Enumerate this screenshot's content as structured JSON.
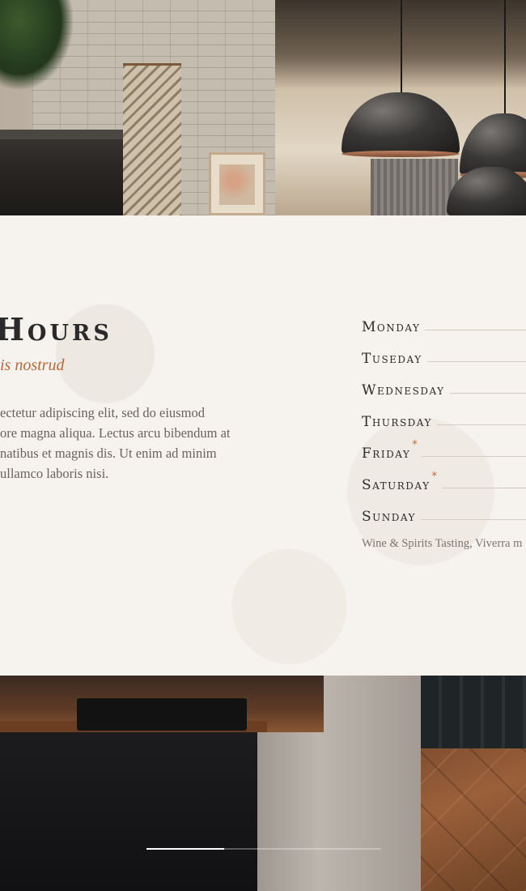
{
  "section": {
    "heading": "Hours",
    "subtitle": "is nostrud",
    "body_lines": [
      "ectetur adipiscing elit, sed do eiusmod",
      "ore magna aliqua. Lectus arcu bibendum at",
      "natibus et magnis dis. Ut enim ad minim",
      "ullamco laboris nisi."
    ]
  },
  "hours": {
    "days": [
      {
        "label": "Monday",
        "starred": false
      },
      {
        "label": "Tuseday",
        "starred": false
      },
      {
        "label": "Wednesday",
        "starred": false
      },
      {
        "label": "Thursday",
        "starred": false
      },
      {
        "label": "Friday",
        "starred": true
      },
      {
        "label": "Saturday",
        "starred": true
      },
      {
        "label": "Sunday",
        "starred": false
      }
    ],
    "star_symbol": "*",
    "note": "Wine & Spirits Tasting, Viverra m"
  },
  "slider": {
    "slides": 3,
    "active_index": 0
  },
  "colors": {
    "accent": "#b4693a",
    "panel": "#f6f3ee",
    "heading": "#2a2a2a"
  }
}
